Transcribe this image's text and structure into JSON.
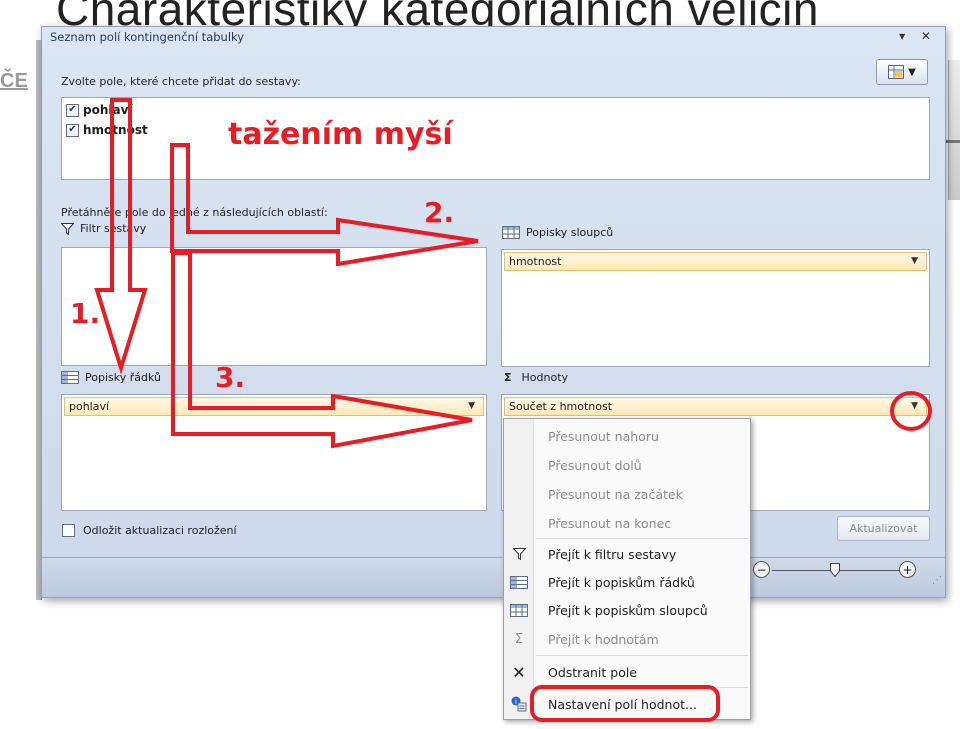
{
  "slide": {
    "title": "Charakteristiky kategoriálních veličin",
    "left_fragment": "ČE"
  },
  "pane": {
    "title": "Seznam polí kontingenční tabulky",
    "window_controls": "▾ ✕",
    "instruction": "Zvolte pole, které chcete přidat do sestavy:",
    "fields": [
      {
        "label": "pohlaví",
        "checked": true
      },
      {
        "label": "hmotnost",
        "checked": true
      }
    ],
    "drag_instruction": "Přetáhněte pole do jedné z následujících oblastí:",
    "areas": {
      "filter": {
        "label": "Filtr sestavy"
      },
      "columns": {
        "label": "Popisky sloupců",
        "field": "hmotnost"
      },
      "rows": {
        "label": "Popisky řádků",
        "field": "pohlaví"
      },
      "values": {
        "label": "Hodnoty",
        "field": "Součet z hmotnost"
      }
    },
    "defer_label": "Odložit aktualizaci rozložení",
    "defer_checked": false,
    "update_button": "Aktualizovat"
  },
  "context_menu": {
    "items": [
      {
        "label": "Přesunout nahoru",
        "icon": "",
        "enabled": false
      },
      {
        "label": "Přesunout dolů",
        "icon": "",
        "enabled": false
      },
      {
        "label": "Přesunout na začátek",
        "icon": "",
        "enabled": false
      },
      {
        "label": "Přesunout na konec",
        "icon": "",
        "enabled": false
      },
      {
        "label": "Přejít k filtru sestavy",
        "icon": "filter-icon",
        "enabled": true
      },
      {
        "label": "Přejít k popiskům řádků",
        "icon": "row-labels-icon",
        "enabled": true
      },
      {
        "label": "Přejít k popiskům sloupců",
        "icon": "column-labels-icon",
        "enabled": true
      },
      {
        "label": "Přejít k hodnotám",
        "icon": "sigma-icon",
        "enabled": false
      },
      {
        "label": "Odstranit pole",
        "icon": "remove-icon",
        "enabled": true
      },
      {
        "label": "Nastavení polí hodnot...",
        "icon": "field-settings-icon",
        "enabled": true
      }
    ]
  },
  "annotations": {
    "drag_note": "tažením myší",
    "step1": "1.",
    "step2": "2.",
    "step3": "3.",
    "color": "#e81c24"
  }
}
